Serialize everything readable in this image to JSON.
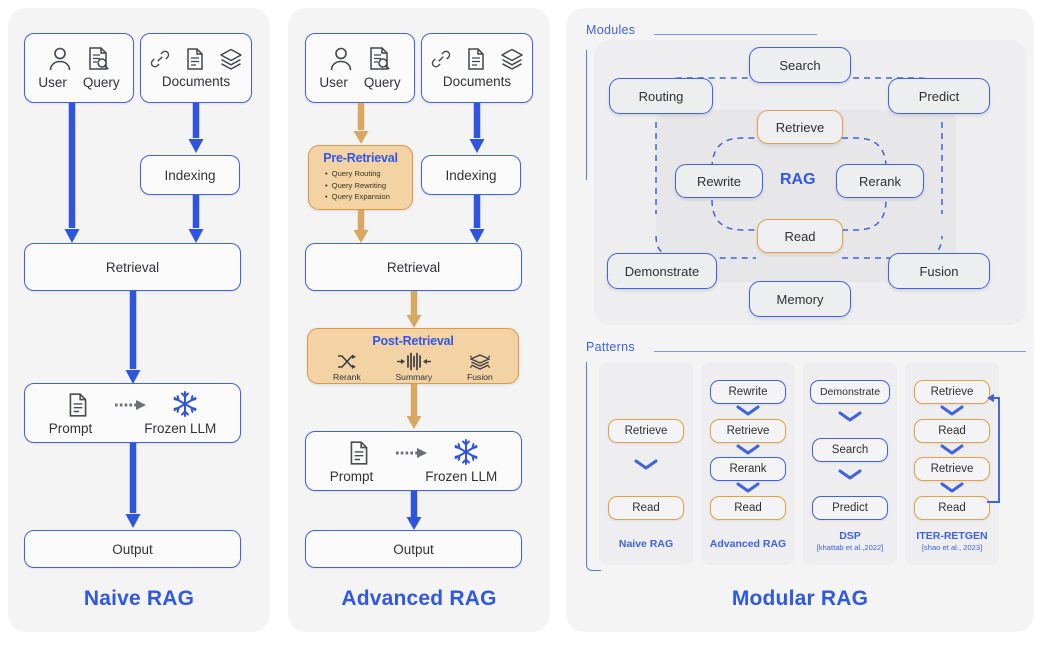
{
  "panels": {
    "naive": {
      "title": "Naive RAG",
      "nodes": {
        "user": "User",
        "query": "Query",
        "documents": "Documents",
        "indexing": "Indexing",
        "retrieval": "Retrieval",
        "prompt": "Prompt",
        "frozen_llm": "Frozen LLM",
        "output": "Output"
      }
    },
    "advanced": {
      "title": "Advanced RAG",
      "nodes": {
        "user": "User",
        "query": "Query",
        "documents": "Documents",
        "indexing": "Indexing",
        "retrieval": "Retrieval",
        "prompt": "Prompt",
        "frozen_llm": "Frozen LLM",
        "output": "Output"
      },
      "pre_retrieval": {
        "title": "Pre-Retrieval",
        "items": [
          "Query Routing",
          "Query Rewriting",
          "Query Expansion"
        ]
      },
      "post_retrieval": {
        "title": "Post-Retrieval",
        "items": [
          "Rerank",
          "Summary",
          "Fusion"
        ]
      }
    },
    "modular": {
      "title": "Modular RAG",
      "modules_label": "Modules",
      "patterns_label": "Patterns",
      "core_label": "RAG",
      "modules": {
        "search": "Search",
        "routing": "Routing",
        "predict": "Predict",
        "retrieve": "Retrieve",
        "rewrite": "Rewrite",
        "rerank": "Rerank",
        "read": "Read",
        "demonstrate": "Demonstrate",
        "fusion": "Fusion",
        "memory": "Memory"
      },
      "patterns": [
        {
          "name": "naive-rag-pattern",
          "caption": "Naive RAG",
          "citation": "",
          "steps": [
            {
              "label": "Retrieve",
              "style": "orange"
            },
            {
              "label": "Read",
              "style": "orange"
            }
          ]
        },
        {
          "name": "advanced-rag-pattern",
          "caption": "Advanced RAG",
          "citation": "",
          "steps": [
            {
              "label": "Rewrite",
              "style": "blue"
            },
            {
              "label": "Retrieve",
              "style": "orange"
            },
            {
              "label": "Rerank",
              "style": "blue"
            },
            {
              "label": "Read",
              "style": "orange"
            }
          ]
        },
        {
          "name": "dsp-pattern",
          "caption": "DSP",
          "citation": "[khattab et al.,2022]",
          "steps": [
            {
              "label": "Demonstrate",
              "style": "blue"
            },
            {
              "label": "Search",
              "style": "blue"
            },
            {
              "label": "Predict",
              "style": "blue"
            }
          ]
        },
        {
          "name": "iter-retgen-pattern",
          "caption": "ITER-RETGEN",
          "citation": "[shao et al., 2023]",
          "steps": [
            {
              "label": "Retrieve",
              "style": "orange"
            },
            {
              "label": "Read",
              "style": "orange"
            },
            {
              "label": "Retrieve",
              "style": "orange"
            },
            {
              "label": "Read",
              "style": "orange"
            }
          ]
        }
      ]
    }
  },
  "colors": {
    "accent_blue": "#2f57e8",
    "border_blue": "#3f62e5",
    "arrow_blue": "#2f55e0",
    "orange_fill": "#f3d2a4",
    "orange_border": "#d99a4e",
    "arrow_tan": "#d8a762",
    "panel_bg": "#f4f4f5"
  },
  "icons": {
    "user": "user-icon",
    "query": "query-document-search-icon",
    "link": "link-icon",
    "document": "document-icon",
    "layers": "layers-icon",
    "prompt": "prompt-document-icon",
    "frozen": "snowflake-icon",
    "rerank": "shuffle-icon",
    "summary": "waveform-compress-icon",
    "fusion": "fusion-layers-icon",
    "arrow_small": "dashed-arrow-icon"
  }
}
